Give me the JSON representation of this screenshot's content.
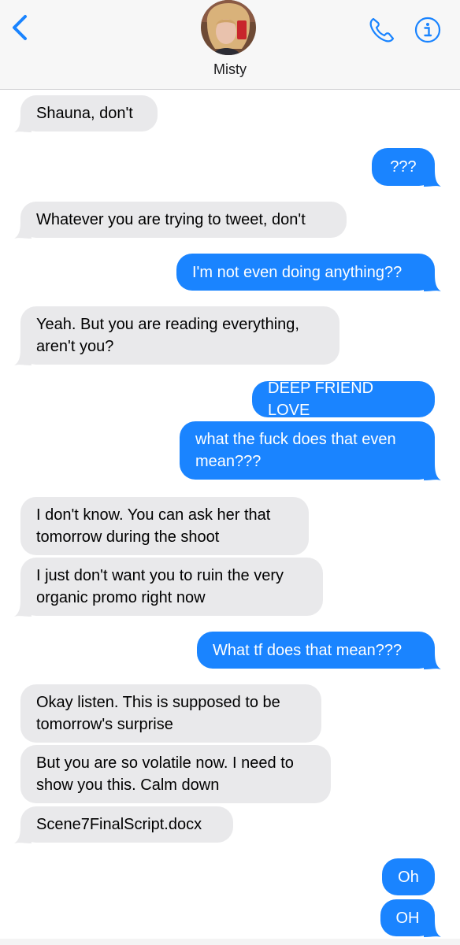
{
  "header": {
    "contact_name": "Misty",
    "back_icon": "chevron-left-icon",
    "phone_icon": "phone-icon",
    "info_icon": "info-icon",
    "accent_color": "#1a84ff"
  },
  "messages": [
    {
      "from": "them",
      "text": "Shauna, don't"
    },
    {
      "from": "me",
      "text": "???"
    },
    {
      "from": "them",
      "text": "Whatever you are trying to tweet, don't"
    },
    {
      "from": "me",
      "text": "I'm not even doing anything??"
    },
    {
      "from": "them",
      "text": "Yeah. But you are reading everything,\naren't you?"
    },
    {
      "from": "me",
      "text": "DEEP FRIEND LOVE"
    },
    {
      "from": "me",
      "text": "what the fuck does that even\nmean???"
    },
    {
      "from": "them",
      "text": "I don't know. You can ask her that\ntomorrow during the shoot"
    },
    {
      "from": "them",
      "text": "I just don't want you to ruin the very\norganic promo right now"
    },
    {
      "from": "me",
      "text": "What tf does that mean???"
    },
    {
      "from": "them",
      "text": "Okay listen. This is supposed to be\ntomorrow's surprise"
    },
    {
      "from": "them",
      "text": "But you are so volatile now. I need to\nshow you this. Calm down"
    },
    {
      "from": "them",
      "text": "Scene7FinalScript.docx"
    },
    {
      "from": "me",
      "text": "Oh"
    },
    {
      "from": "me",
      "text": "OH"
    }
  ]
}
